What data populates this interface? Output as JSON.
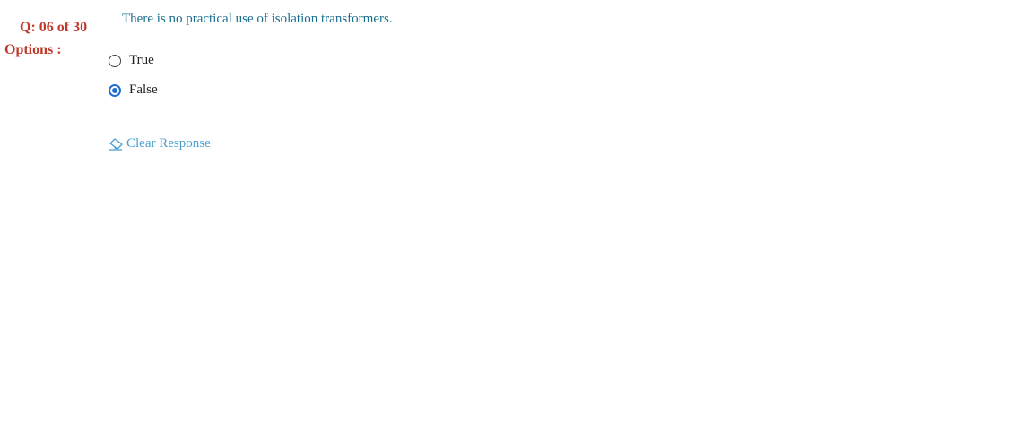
{
  "question": {
    "number_label": "Q: 06 of 30",
    "options_heading": "Options :",
    "text": "There is no practical use of isolation transformers.",
    "options": [
      {
        "label": "True",
        "selected": false
      },
      {
        "label": "False",
        "selected": true
      }
    ]
  },
  "actions": {
    "clear_response_label": "Clear Response",
    "clear_response_icon": "eraser-icon"
  },
  "colors": {
    "question_meta": "#c0392b",
    "question_text": "#1a6f8f",
    "radio_selected": "#1f6fd1",
    "link": "#4a9ed0"
  }
}
